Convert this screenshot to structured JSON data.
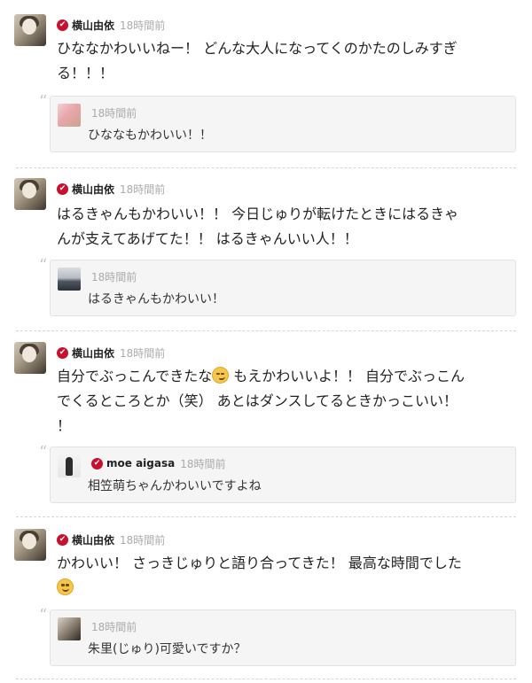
{
  "posts": [
    {
      "author": "横山由依",
      "time": "18時間前",
      "text_lines": [
        "ひななかわいいねー！ どんな大人になってくのかたのしみすぎ",
        "る！！！"
      ],
      "reply": {
        "author": "",
        "time": "18時間前",
        "text": "ひななもかわいい！！"
      }
    },
    {
      "author": "横山由依",
      "time": "18時間前",
      "text_lines": [
        "はるきゃんもかわいい！！ 今日じゅりが転けたときにはるきゃ",
        "んが支えてあげてた！！ はるきゃんいい人！！"
      ],
      "reply": {
        "author": "",
        "time": "18時間前",
        "text": "はるきゃんもかわいい！"
      }
    },
    {
      "author": "横山由依",
      "time": "18時間前",
      "text_lines": [
        "自分でぶっこんできたな",
        " もえかわいいよ！！ 自分でぶっこん",
        "でくるところとか（笑） あとはダンスしてるときかっこいい！",
        "！"
      ],
      "reply": {
        "author": "moe aigasa",
        "time": "18時間前",
        "text": "相笠萌ちゃんかわいいですよね"
      }
    },
    {
      "author": "横山由依",
      "time": "18時間前",
      "text_lines": [
        "かわいい！ さっきじゅりと語り合ってきた！ 最高な時間でした"
      ],
      "reply": {
        "author": "",
        "time": "18時間前",
        "text": "朱里(じゅり)可愛いですか？"
      }
    }
  ],
  "icons": {
    "verified": "verified-check-icon",
    "quote": "quote-mark-icon",
    "emoji_smirk": "smirk-emoji-icon",
    "emoji_smile": "smile-emoji-icon"
  },
  "glyphs": {
    "check": "✔",
    "quote": "“"
  },
  "colors": {
    "verified": "#c8102e",
    "time": "#aaaaaa",
    "reply_bg": "#f5f5f5"
  }
}
